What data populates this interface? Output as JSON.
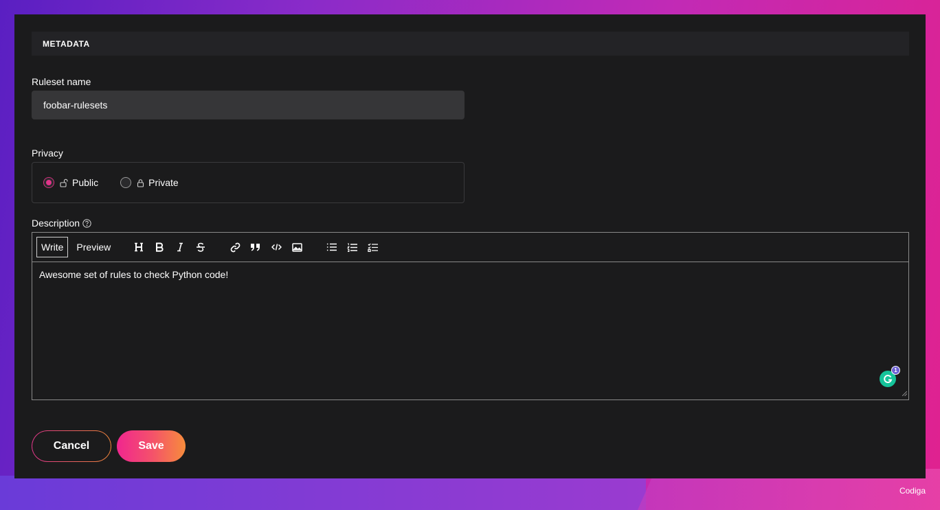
{
  "metadata_section": {
    "title": "METADATA"
  },
  "ruleset_name": {
    "label": "Ruleset name",
    "value": "foobar-rulesets"
  },
  "privacy": {
    "label": "Privacy",
    "options": [
      {
        "label": "Public",
        "selected": true,
        "icon": "unlock-icon"
      },
      {
        "label": "Private",
        "selected": false,
        "icon": "lock-icon"
      }
    ]
  },
  "description": {
    "label": "Description",
    "tabs": [
      "Write",
      "Preview"
    ],
    "active_tab": "Write",
    "content": "Awesome set of rules to check Python code!",
    "toolbar_icons": [
      "heading-icon",
      "bold-icon",
      "italic-icon",
      "strikethrough-icon",
      "link-icon",
      "quote-icon",
      "code-icon",
      "image-icon",
      "bulleted-list-icon",
      "numbered-list-icon",
      "checklist-icon"
    ],
    "grammarly_count": "1"
  },
  "actions": {
    "cancel_label": "Cancel",
    "save_label": "Save"
  },
  "footer": {
    "brand": "Codiga"
  },
  "colors": {
    "accent_pink": "#e0358a",
    "accent_orange": "#f78c3c",
    "panel_bg": "#1b1b1c",
    "grammarly": "#15c39a"
  }
}
